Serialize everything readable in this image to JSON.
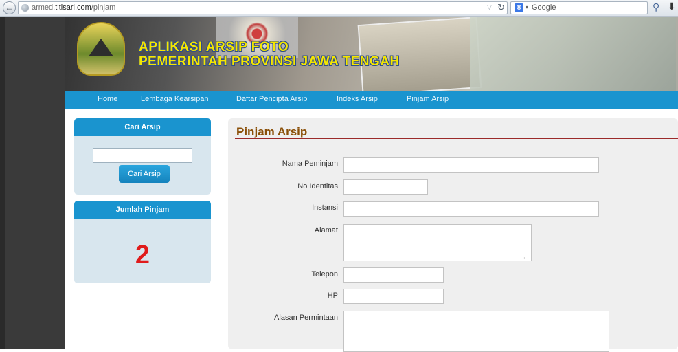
{
  "browser": {
    "url_prefix": "armed.",
    "url_domain": "titisari.com",
    "url_path": "/pinjam",
    "search_placeholder": "Google"
  },
  "header": {
    "title_line1": "APLIKASI ARSIP FOTO",
    "title_line2": "PEMERINTAH PROVINSI JAWA TENGAH"
  },
  "nav": {
    "items": [
      {
        "label": "Home"
      },
      {
        "label": "Lembaga Kearsipan"
      },
      {
        "label": "Daftar Pencipta Arsip"
      },
      {
        "label": "Indeks Arsip"
      },
      {
        "label": "Pinjam Arsip"
      }
    ]
  },
  "sidebar": {
    "search": {
      "title": "Cari Arsip",
      "input_value": "",
      "button_label": "Cari Arsip"
    },
    "count": {
      "title": "Jumlah Pinjam",
      "value": "2"
    }
  },
  "main": {
    "title": "Pinjam Arsip",
    "fields": [
      {
        "label": "Nama Peminjam",
        "value": ""
      },
      {
        "label": "No Identitas",
        "value": ""
      },
      {
        "label": "Instansi",
        "value": ""
      },
      {
        "label": "Alamat",
        "value": ""
      },
      {
        "label": "Telepon",
        "value": ""
      },
      {
        "label": "HP",
        "value": ""
      },
      {
        "label": "Alasan Permintaan",
        "value": ""
      }
    ]
  },
  "colors": {
    "nav_blue": "#1a94cf",
    "title_brown": "#8a4f07",
    "count_red": "#e01b1b",
    "header_yellow": "#f5e600"
  }
}
